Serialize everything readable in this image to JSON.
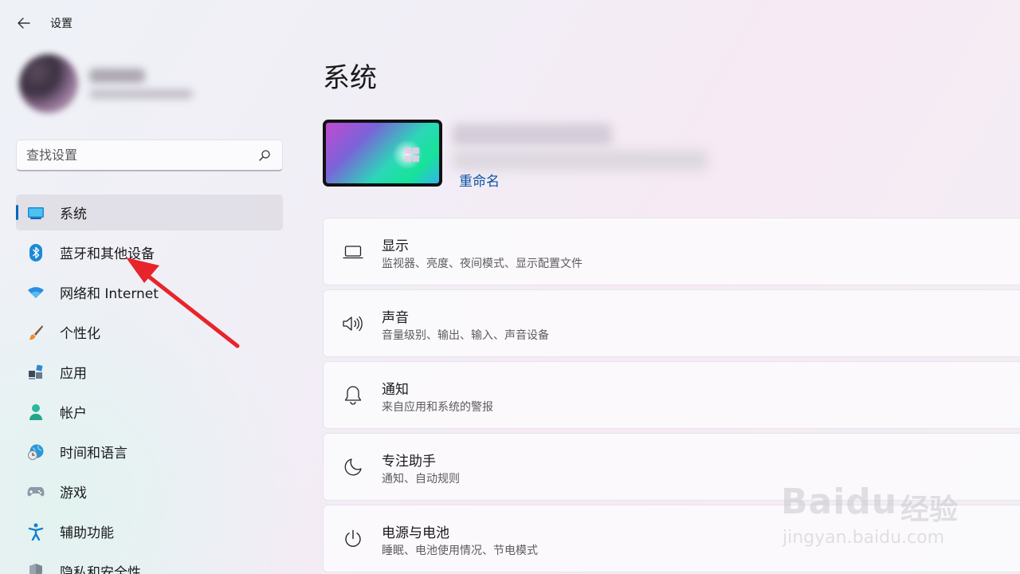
{
  "window": {
    "title": "设置"
  },
  "search": {
    "placeholder": "查找设置"
  },
  "nav": {
    "items": [
      {
        "label": "系统",
        "icon": "monitor-icon",
        "active": true
      },
      {
        "label": "蓝牙和其他设备",
        "icon": "bluetooth-icon"
      },
      {
        "label": "网络和 Internet",
        "icon": "wifi-icon"
      },
      {
        "label": "个性化",
        "icon": "brush-icon"
      },
      {
        "label": "应用",
        "icon": "apps-icon"
      },
      {
        "label": "帐户",
        "icon": "person-icon"
      },
      {
        "label": "时间和语言",
        "icon": "globe-clock-icon"
      },
      {
        "label": "游戏",
        "icon": "gamepad-icon"
      },
      {
        "label": "辅助功能",
        "icon": "accessibility-icon"
      },
      {
        "label": "隐私和安全性",
        "icon": "shield-icon"
      }
    ]
  },
  "main": {
    "title": "系统",
    "device": {
      "rename_label": "重命名"
    },
    "cards": [
      {
        "title": "显示",
        "subtitle": "监视器、亮度、夜间模式、显示配置文件",
        "icon": "laptop-icon"
      },
      {
        "title": "声音",
        "subtitle": "音量级别、输出、输入、声音设备",
        "icon": "speaker-icon"
      },
      {
        "title": "通知",
        "subtitle": "来自应用和系统的警报",
        "icon": "bell-icon"
      },
      {
        "title": "专注助手",
        "subtitle": "通知、自动规则",
        "icon": "moon-icon"
      },
      {
        "title": "电源与电池",
        "subtitle": "睡眠、电池使用情况、节电模式",
        "icon": "power-icon"
      }
    ]
  },
  "watermark": {
    "brand": "Baidu",
    "brand_cn": "经验",
    "url": "jingyan.baidu.com"
  },
  "colors": {
    "accent": "#0067c0",
    "annotation_arrow": "#e8242b",
    "link": "#0a52a3"
  }
}
